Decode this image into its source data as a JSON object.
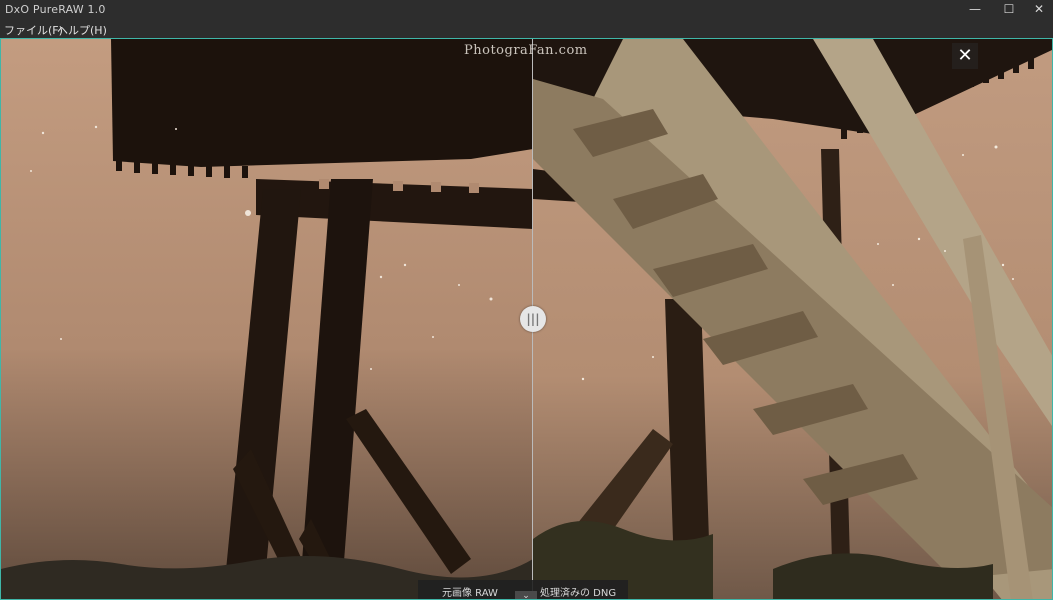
{
  "window": {
    "title": "DxO PureRAW 1.0",
    "minimize_glyph": "—",
    "maximize_glyph": "☐",
    "close_glyph": "✕"
  },
  "menu": {
    "file": "ファイル(F)",
    "help": "ヘルプ(H)"
  },
  "viewer": {
    "watermark": "PhotograFan.com",
    "close_glyph": "✕",
    "handle_glyph": "|||",
    "label_left": "元画像 RAW",
    "label_right": "処理済みの DNG",
    "chevron_glyph": "⌄"
  },
  "colors": {
    "accent_border": "#3fb6a8",
    "sky_left": "#b58e74",
    "sky_right": "#b99477",
    "wood_dark": "#1e140e",
    "wood_light": "#b7a68a"
  }
}
